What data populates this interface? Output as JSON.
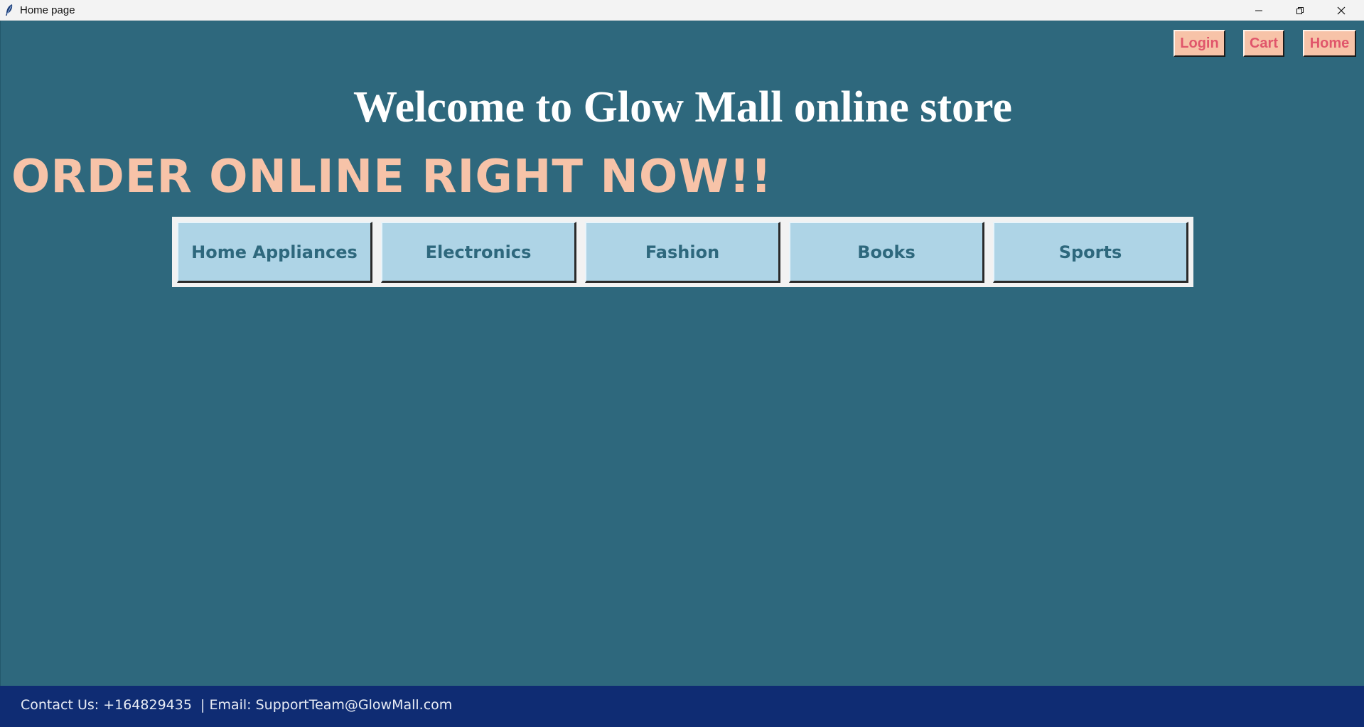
{
  "window": {
    "title": "Home page",
    "controls": {
      "minimize_icon": "minimize-icon",
      "maximize_icon": "restore-icon",
      "close_icon": "close-icon"
    }
  },
  "header": {
    "login_label": "Login",
    "cart_label": "Cart",
    "home_label": "Home"
  },
  "main": {
    "welcome_title": "Welcome to Glow Mall online store",
    "promo_text": "ORDER ONLINE RIGHT NOW!!",
    "categories": [
      {
        "label": "Home Appliances"
      },
      {
        "label": "Electronics"
      },
      {
        "label": "Fashion"
      },
      {
        "label": "Books"
      },
      {
        "label": "Sports"
      }
    ]
  },
  "footer": {
    "contact_text": "Contact Us: +164829435  | Email: SupportTeam@GlowMall.com"
  },
  "colors": {
    "background": "#2e687d",
    "accent_peach": "#f7c3a8",
    "top_button_text": "#e0566b",
    "category_button_bg": "#aed4e6",
    "footer_bg": "#0f2c73"
  }
}
